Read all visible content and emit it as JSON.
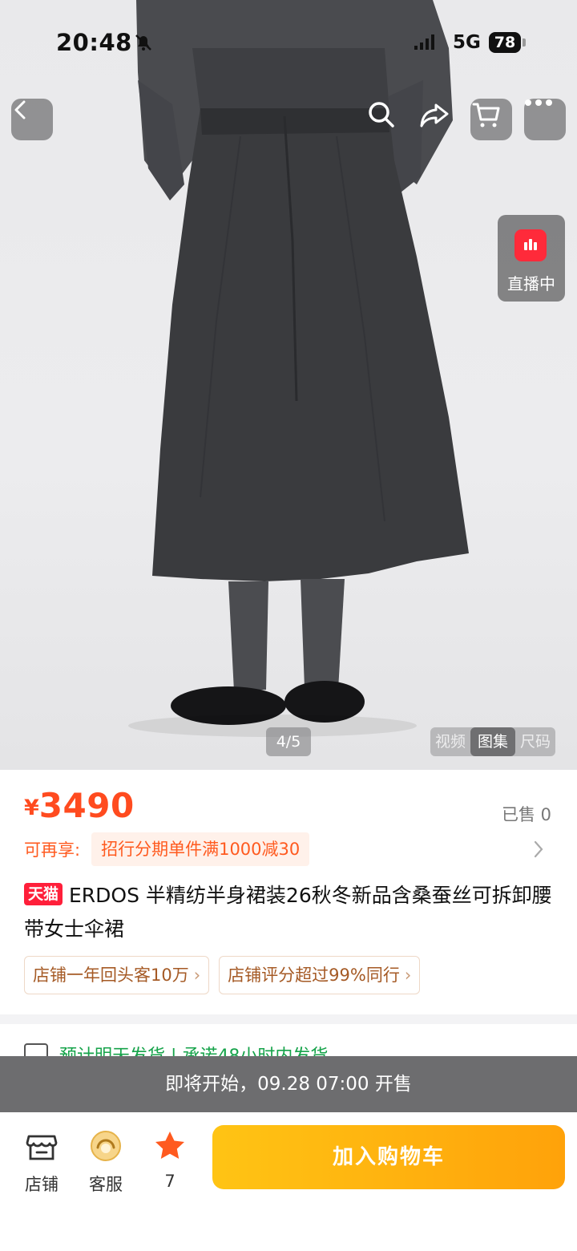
{
  "status_bar": {
    "time": "20:48",
    "network": "5G",
    "battery": "78"
  },
  "top_actions": [
    "back",
    "search",
    "share",
    "cart",
    "more"
  ],
  "live": {
    "label": "直播中"
  },
  "gallery": {
    "counter": "4/5",
    "tabs": [
      "视频",
      "图集",
      "尺码"
    ],
    "active_tab": "图集"
  },
  "product": {
    "currency": "¥",
    "price": "3490",
    "sold": "已售 0",
    "promo_label": "可再享:",
    "promo_value": "招行分期单件满1000减30",
    "badge": "天猫",
    "title": "ERDOS 半精纺半身裙装26秋冬新品含桑蚕丝可拆卸腰带女士伞裙",
    "tags": [
      {
        "label": "店铺一年回头客10万",
        "chevron": "›"
      },
      {
        "label": "店铺评分超过99%同行",
        "chevron": "›"
      }
    ]
  },
  "delivery": {
    "text": "预计明天发货 | 承诺48小时内发货"
  },
  "notice": {
    "text": "即将开始，09.28 07:00 开售"
  },
  "bottom_bar": {
    "store_label": "店铺",
    "service_label": "客服",
    "fav_count": "7",
    "cart_button": "加入购物车"
  },
  "colors": {
    "price": "#ff4b1f",
    "tmall": "#ff1f3a",
    "cart_button": "#ffb10f",
    "delivery": "#16a34a"
  }
}
